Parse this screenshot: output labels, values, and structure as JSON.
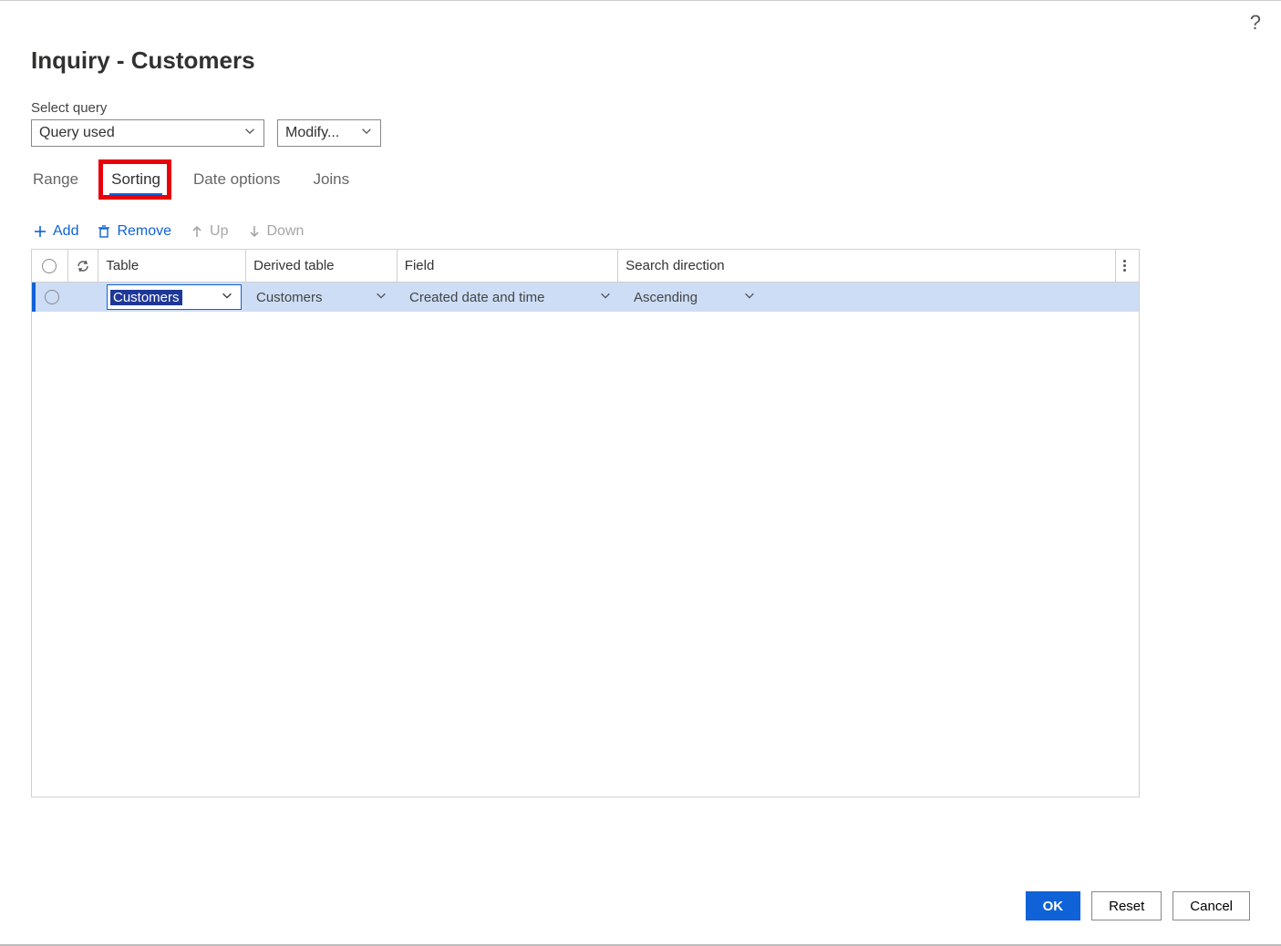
{
  "header": {
    "title": "Inquiry - Customers",
    "select_query_label": "Select query",
    "query_value": "Query used",
    "modify_label": "Modify..."
  },
  "tabs": {
    "range": "Range",
    "sorting": "Sorting",
    "date_options": "Date options",
    "joins": "Joins",
    "active": "sorting"
  },
  "toolbar": {
    "add": "Add",
    "remove": "Remove",
    "up": "Up",
    "down": "Down"
  },
  "grid": {
    "columns": {
      "table": "Table",
      "derived": "Derived table",
      "field": "Field",
      "direction": "Search direction"
    },
    "rows": [
      {
        "table": "Customers",
        "derived": "Customers",
        "field": "Created date and time",
        "direction": "Ascending"
      }
    ]
  },
  "footer": {
    "ok": "OK",
    "reset": "Reset",
    "cancel": "Cancel"
  },
  "annotation": {
    "highlight_tab": "sorting"
  }
}
